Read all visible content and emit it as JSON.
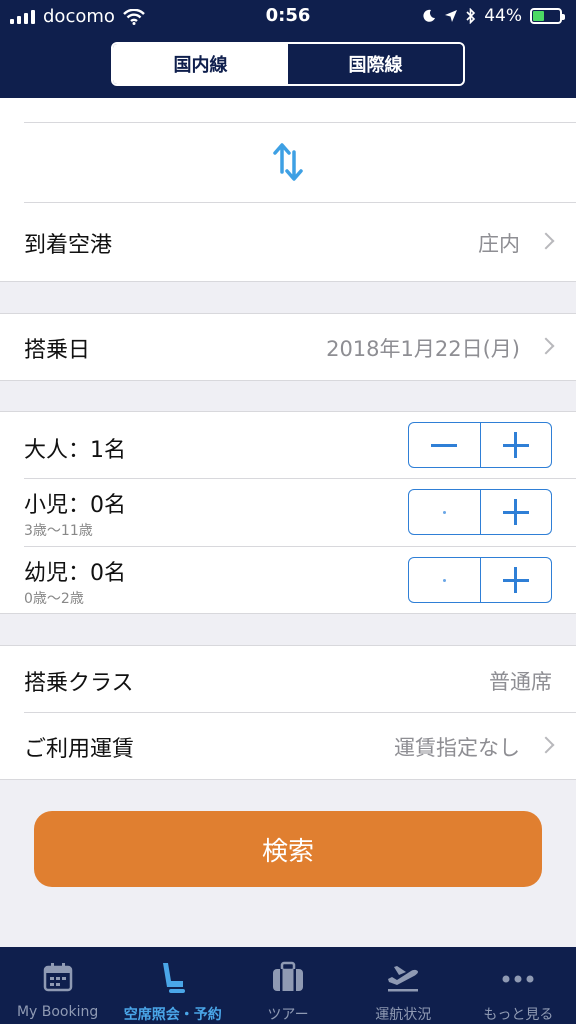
{
  "status_bar": {
    "carrier": "docomo",
    "time": "0:56",
    "battery": "44%",
    "battery_fraction": 0.44
  },
  "segment": {
    "domestic": "国内線",
    "international": "国際線",
    "selected": "domestic"
  },
  "route": {
    "arrival_label": "到着空港",
    "arrival_value": "庄内"
  },
  "date": {
    "label": "搭乗日",
    "value": "2018年1月22日(月)"
  },
  "passengers": [
    {
      "label": "大人：1名",
      "sub": ""
    },
    {
      "label": "小児：0名",
      "sub": "3歳〜11歳"
    },
    {
      "label": "幼児：0名",
      "sub": "0歳〜2歳"
    }
  ],
  "class": {
    "label": "搭乗クラス",
    "value": "普通席"
  },
  "fare": {
    "label": "ご利用運賃",
    "value": "運賃指定なし"
  },
  "search_button": "検索",
  "colors": {
    "navy": "#0f1f4d",
    "accent": "#2f7fd6",
    "orange": "#e07f30",
    "active_tab": "#4aa6e8"
  },
  "tabs": [
    {
      "label": "My Booking",
      "icon": "calendar-icon"
    },
    {
      "label": "空席照会・予約",
      "icon": "seat-icon",
      "active": true
    },
    {
      "label": "ツアー",
      "icon": "suitcase-icon"
    },
    {
      "label": "運航状況",
      "icon": "plane-departure-icon"
    },
    {
      "label": "もっと見る",
      "icon": "more-icon"
    }
  ]
}
